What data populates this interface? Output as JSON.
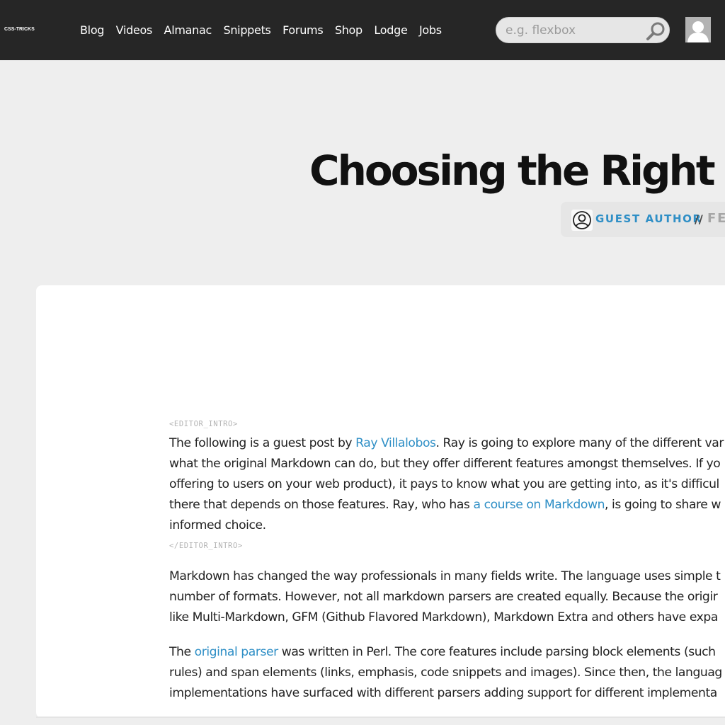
{
  "header": {
    "logo_text": "CSS-TRICKS",
    "nav": [
      "Blog",
      "Videos",
      "Almanac",
      "Snippets",
      "Forums",
      "Shop",
      "Lodge",
      "Jobs"
    ],
    "search_placeholder": "e.g. flexbox"
  },
  "article": {
    "title": "Choosing the Right I",
    "byline": {
      "author": "GUEST AUTHOR",
      "separator": "//",
      "date": "FE"
    },
    "editor_intro_open": "<EDITOR_INTRO>",
    "editor_intro_close": "</EDITOR_INTRO>",
    "intro": {
      "l1_a": "The following is a guest post by ",
      "l1_link": "Ray Villalobos",
      "l1_b": ". Ray is going to explore many of the different var",
      "l2": "what the original Markdown can do, but they offer different features amongst themselves. If yo",
      "l3": "offering to users on your web product), it pays to know what you are getting into, as it's difficul",
      "l4_a": "there that depends on those features. Ray, who has ",
      "l4_link": "a course on Markdown",
      "l4_b": ", is going to share w",
      "l5": "informed choice."
    },
    "para2": {
      "l1": "Markdown has changed the way professionals in many fields write. The language uses simple t",
      "l2": "number of formats. However, not all markdown parsers are created equally. Because the origir",
      "l3": "like Multi-Markdown, GFM (Github Flavored Markdown), Markdown Extra and others have expa"
    },
    "para3": {
      "l1_a": "The ",
      "l1_link": "original parser",
      "l1_b": " was written in Perl. The core features include parsing block elements (such",
      "l2": "rules) and span elements (links, emphasis, code snippets and images). Since then, the languag",
      "l3": "implementations have surfaced with different parsers adding support for different implementa"
    }
  }
}
